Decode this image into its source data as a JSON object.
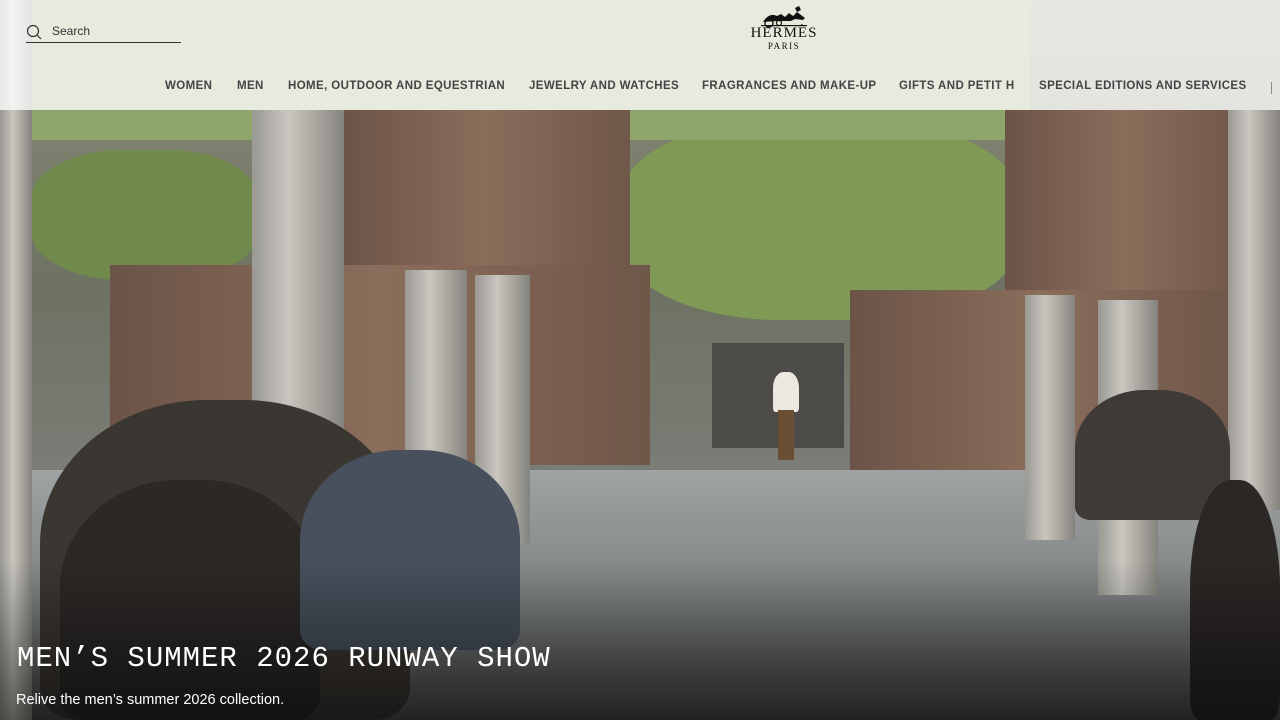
{
  "header": {
    "search": {
      "placeholder": "Search",
      "icon": "search-icon"
    },
    "logo": {
      "name": "HERMÈS",
      "city": "PARIS"
    },
    "nav": [
      {
        "label": "WOMEN"
      },
      {
        "label": "MEN"
      },
      {
        "label": "HOME, OUTDOOR AND EQUESTRIAN"
      },
      {
        "label": "JEWELRY AND WATCHES"
      },
      {
        "label": "FRAGRANCES AND MAKE-UP"
      },
      {
        "label": "GIFTS AND PETIT H"
      },
      {
        "label": "SPECIAL EDITIONS AND SERVICES"
      }
    ]
  },
  "hero": {
    "title": "MEN’S SUMMER 2026 RUNWAY SHOW",
    "subtitle": "Relive the men’s summer 2026 collection."
  }
}
